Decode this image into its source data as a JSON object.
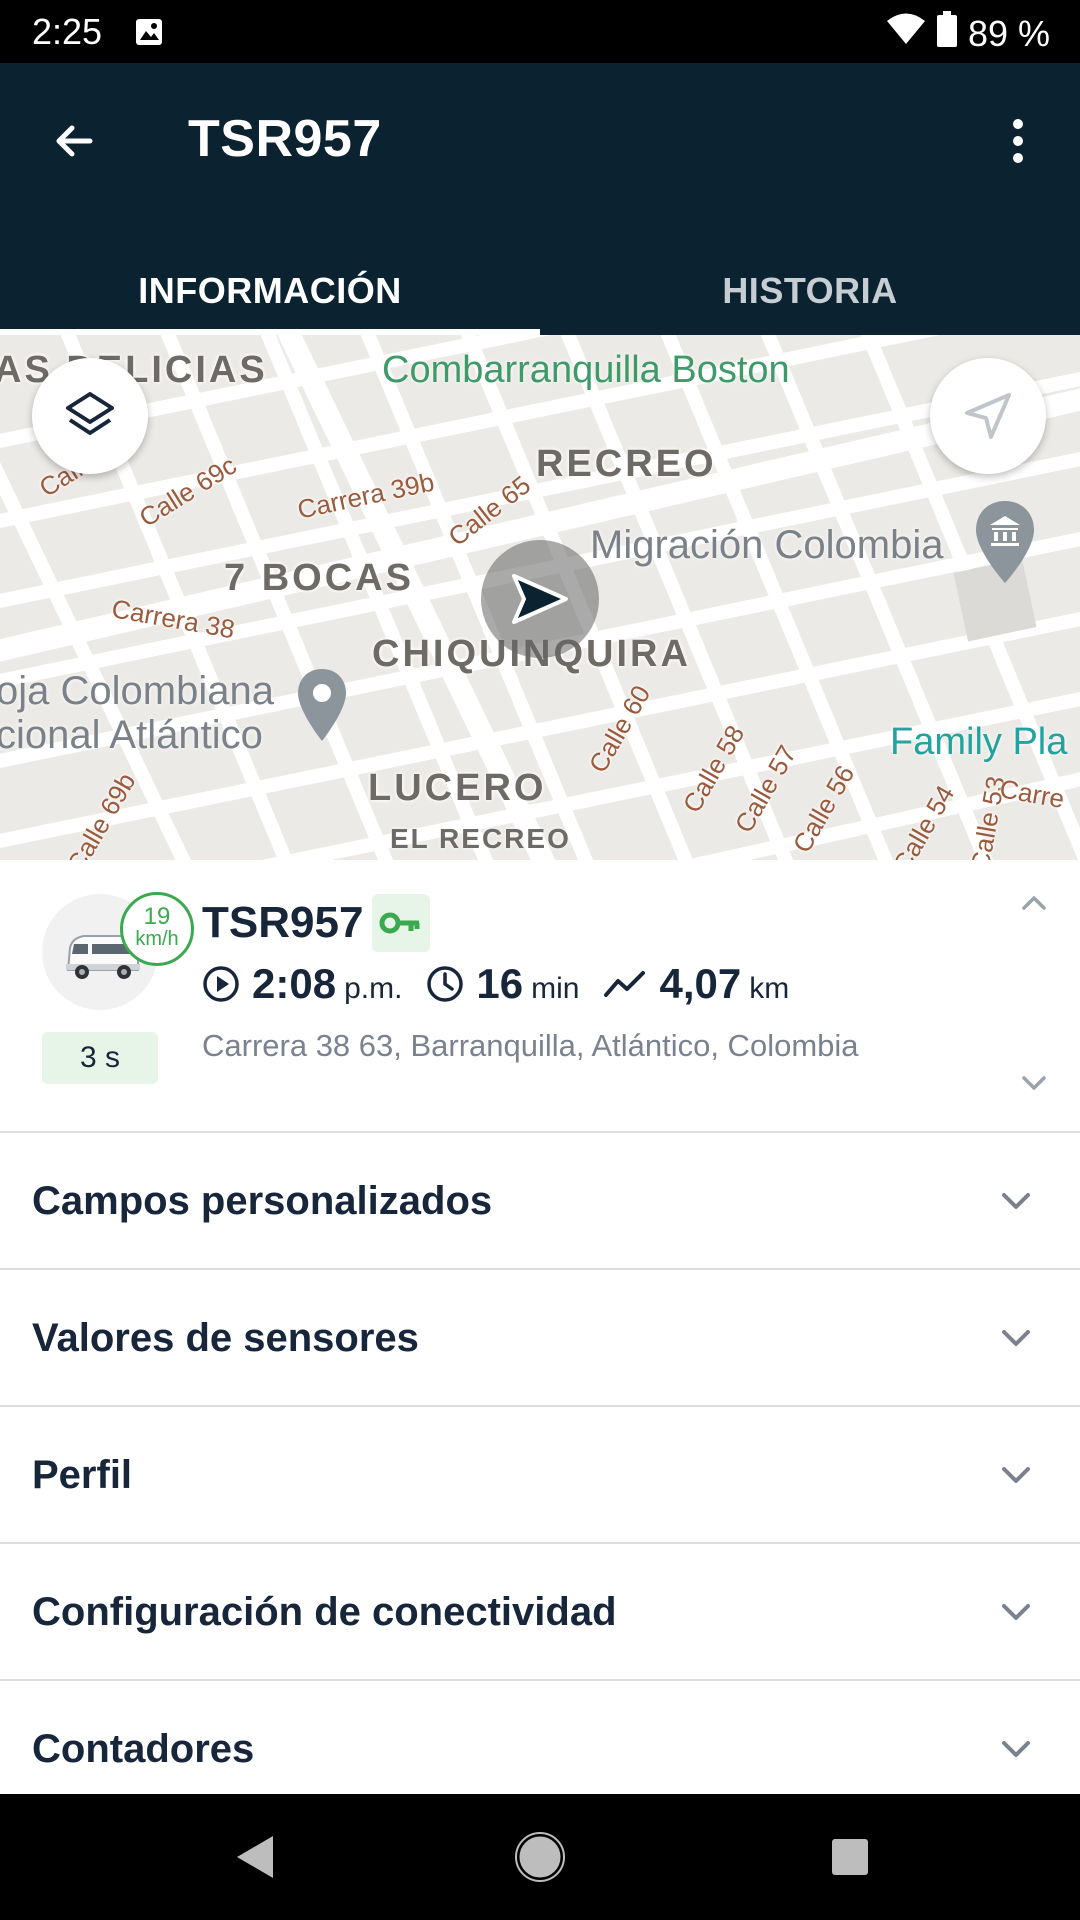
{
  "status_bar": {
    "time": "2:25",
    "battery": "89 %"
  },
  "app_bar": {
    "title": "TSR957"
  },
  "tabs": [
    {
      "label": "INFORMACIÓN",
      "selected": true
    },
    {
      "label": "HISTORIA",
      "selected": false
    }
  ],
  "map": {
    "neighborhoods": [
      "AS DELICIAS",
      "RECREO",
      "7 BOCAS",
      "CHIQUINQUIRA",
      "LUCERO",
      "EL RECREO"
    ],
    "streets": [
      "Calle 69d",
      "Calle 69c",
      "Carrera 39b",
      "Calle 65",
      "Carrera 38",
      "Calle 60",
      "Calle 58",
      "Calle 57",
      "Calle 56",
      "Calle 54",
      "Calle 53",
      "Calle 69b",
      "Carre"
    ],
    "pois": [
      "Combarranquilla Boston",
      "Migración Colombia",
      "oja Colombiana",
      "cional Atlántico",
      "Family Pla"
    ]
  },
  "vehicle": {
    "name": "TSR957",
    "speed_value": "19",
    "speed_unit": "km/h",
    "age": "3 s",
    "time_value": "2:08",
    "time_unit": "p.m.",
    "duration_value": "16",
    "duration_unit": "min",
    "distance_value": "4,07",
    "distance_unit": "km",
    "address": "Carrera 38 63, Barranquilla, Atlántico, Colombia"
  },
  "sections": [
    {
      "label": "Campos personalizados"
    },
    {
      "label": "Valores de sensores"
    },
    {
      "label": "Perfil"
    },
    {
      "label": "Configuración de conectividad"
    },
    {
      "label": "Contadores"
    }
  ],
  "colors": {
    "app_bar": "#0b2230",
    "accent_green": "#3aa94f",
    "text_dark": "#17263a",
    "text_muted": "#7a8290"
  }
}
